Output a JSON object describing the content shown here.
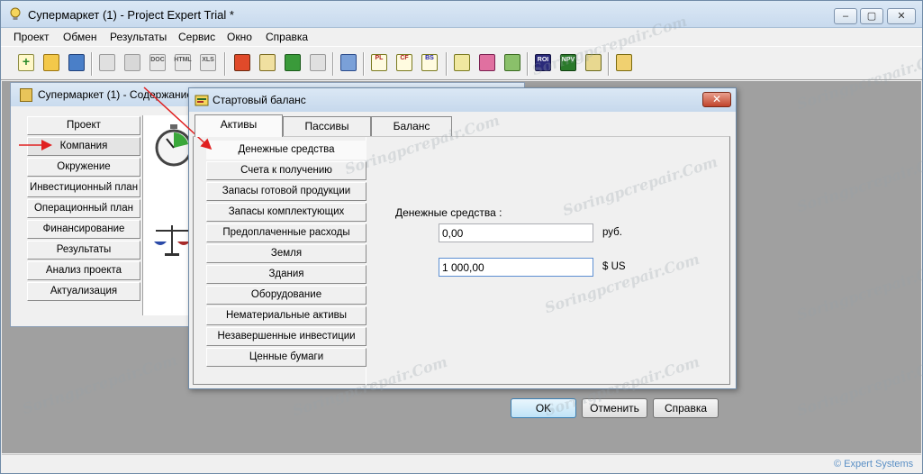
{
  "app": {
    "title": "Супермаркет (1) - Project Expert Trial *",
    "min": "–",
    "max": "▢",
    "close": "✕"
  },
  "menu": [
    "Проект",
    "Обмен",
    "Результаты",
    "Сервис",
    "Окно",
    "Справка"
  ],
  "content_window": {
    "title": "Супермаркет (1) - Содержание",
    "nav": [
      "Проект",
      "Компания",
      "Окружение",
      "Инвестиционный план",
      "Операционный план",
      "Финансирование",
      "Результаты",
      "Анализ проекта",
      "Актуализация"
    ]
  },
  "dialog": {
    "title": "Стартовый баланс",
    "close": "✕",
    "tabs": [
      "Активы",
      "Пассивы",
      "Баланс"
    ],
    "items": [
      "Денежные средства",
      "Счета к получению",
      "Запасы готовой продукции",
      "Запасы комплектующих",
      "Предоплаченные расходы",
      "Земля",
      "Здания",
      "Оборудование",
      "Нематериальные активы",
      "Незавершенные инвестиции",
      "Ценные бумаги"
    ],
    "field_label": "Денежные средства :",
    "rub_value": "0,00",
    "rub_unit": "руб.",
    "usd_value": "1 000,00",
    "usd_unit": "$ US",
    "ok": "OK",
    "cancel": "Отменить",
    "help": "Справка"
  },
  "toolbar_labels": {
    "doc": "DOC",
    "html": "HTML",
    "xls": "XLS",
    "pl": "PL",
    "cf": "CF",
    "bs": "BS",
    "roi": "ROI",
    "npv": "NPV"
  },
  "status": {
    "brand": "© Expert Systems"
  },
  "watermark": "Soringpcrepair.Com",
  "colors": {
    "arrow": "#e02020",
    "accent": "#3c7fb1"
  }
}
